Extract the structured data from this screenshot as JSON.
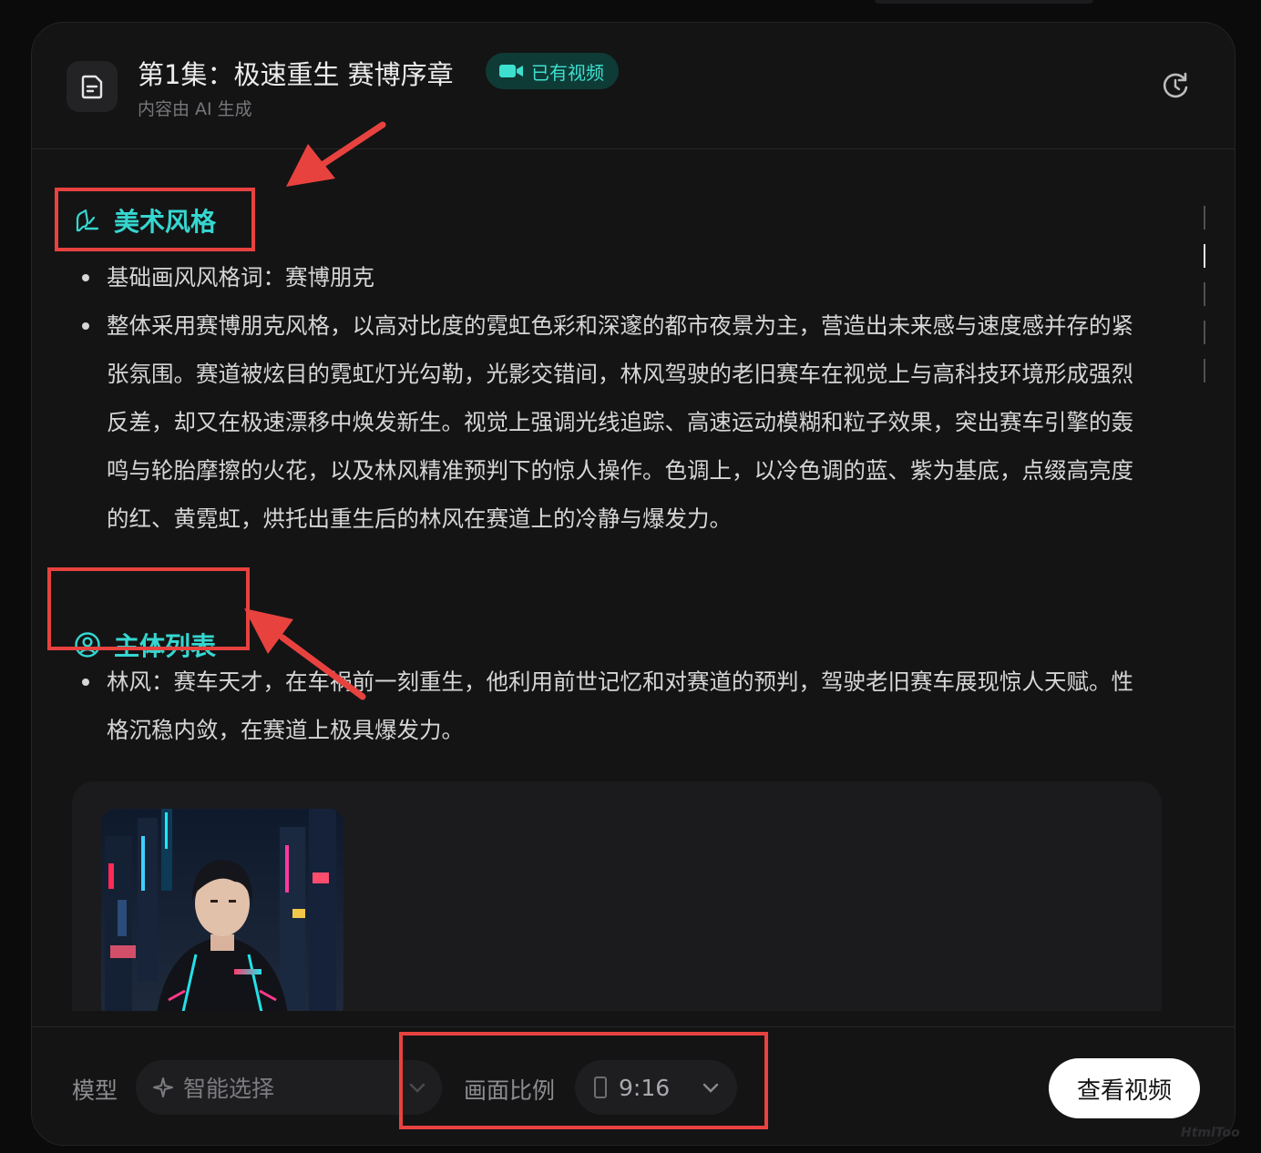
{
  "header": {
    "title": "第1集：极速重生 赛博序章",
    "badge": "已有视频",
    "subtitle": "内容由 AI 生成"
  },
  "art_style": {
    "heading": "美术风格",
    "items": [
      "基础画风风格词：赛博朋克",
      "整体采用赛博朋克风格，以高对比度的霓虹色彩和深邃的都市夜景为主，营造出未来感与速度感并存的紧张氛围。赛道被炫目的霓虹灯光勾勒，光影交错间，林风驾驶的老旧赛车在视觉上与高科技环境形成强烈反差，却又在极速漂移中焕发新生。视觉上强调光线追踪、高速运动模糊和粒子效果，突出赛车引擎的轰鸣与轮胎摩擦的火花，以及林风精准预判下的惊人操作。色调上，以冷色调的蓝、紫为基底，点缀高亮度的红、黄霓虹，烘托出重生后的林风在赛道上的冷静与爆发力。"
    ]
  },
  "subjects": {
    "heading": "主体列表",
    "items": [
      "林风：赛车天才，在车祸前一刻重生，他利用前世记忆和对赛道的预判，驾驶老旧赛车展现惊人天赋。性格沉稳内敛，在赛道上极具爆发力。"
    ]
  },
  "footer": {
    "model_label": "模型",
    "model_value": "智能选择",
    "ratio_label": "画面比例",
    "ratio_value": "9:16",
    "view_button": "查看视频"
  },
  "watermark": "HtmlToo",
  "colors": {
    "accent": "#35d7d0",
    "badge_bg": "#0f3b36",
    "annotation_red": "#e8423f",
    "card_bg": "#141415"
  }
}
